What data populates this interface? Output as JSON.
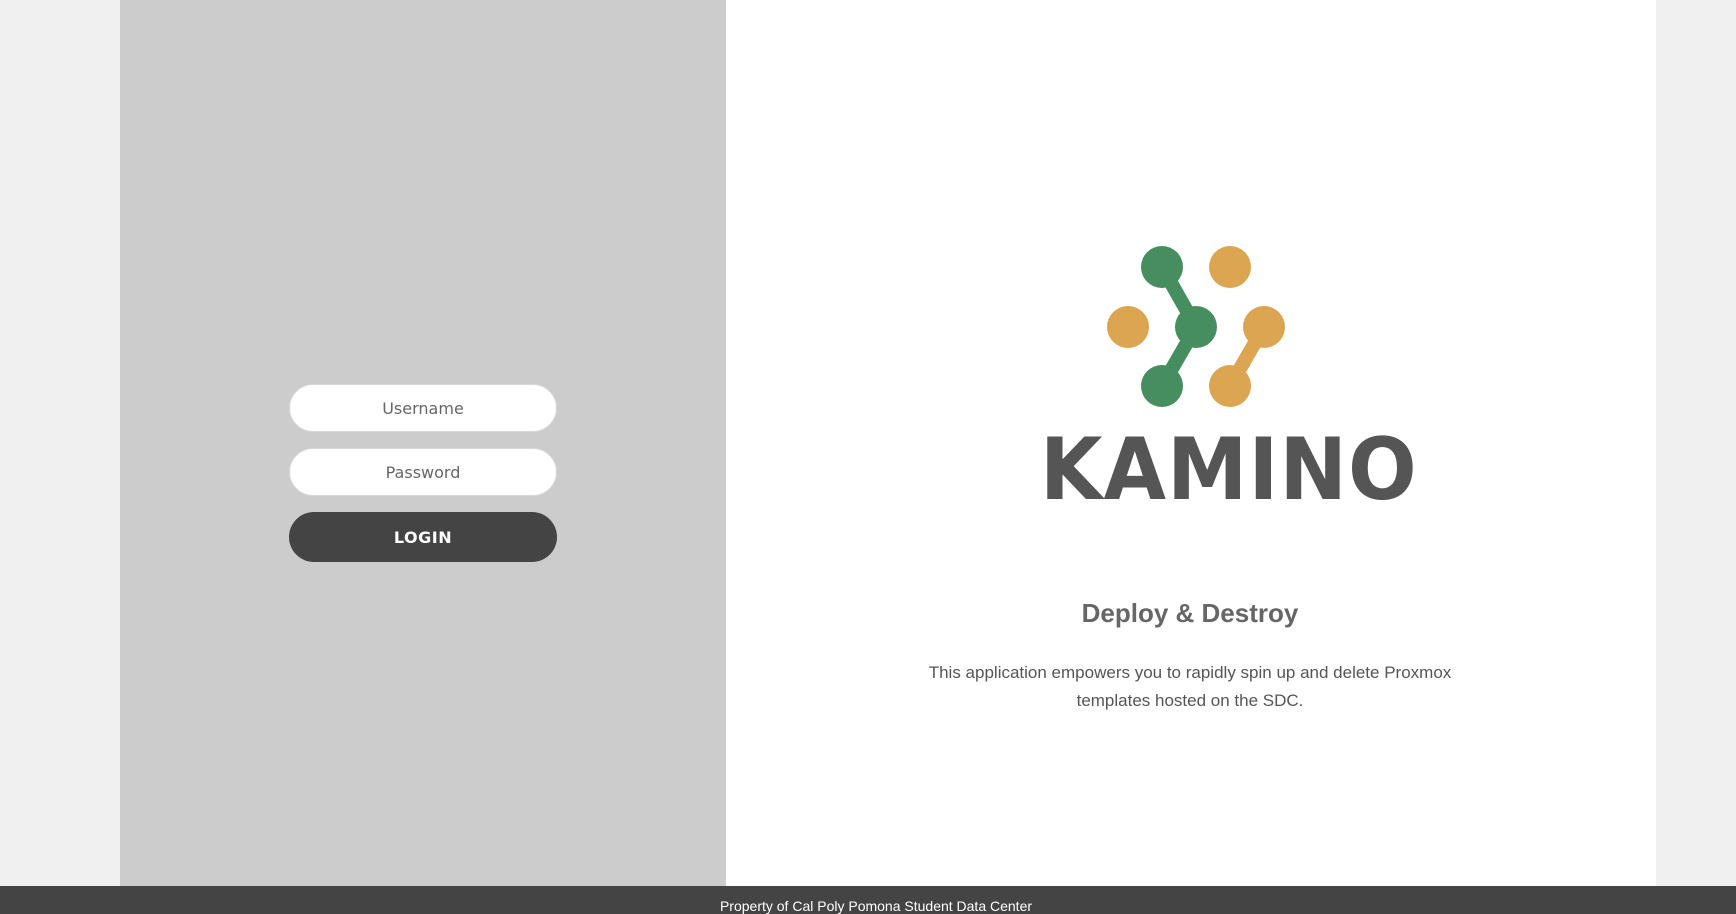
{
  "login": {
    "username_placeholder": "Username",
    "password_placeholder": "Password",
    "button_label": "LOGIN"
  },
  "brand": {
    "name": "KAMINO",
    "logo_icon": "molecule-logo-icon",
    "colors": {
      "green": "#468d5f",
      "gold": "#dca552",
      "text": "#555555"
    }
  },
  "info": {
    "tagline": "Deploy & Destroy",
    "description": "This application empowers you to rapidly spin up and delete Proxmox templates hosted on the SDC."
  },
  "footer": {
    "text": "Property of Cal Poly Pomona Student Data Center"
  }
}
